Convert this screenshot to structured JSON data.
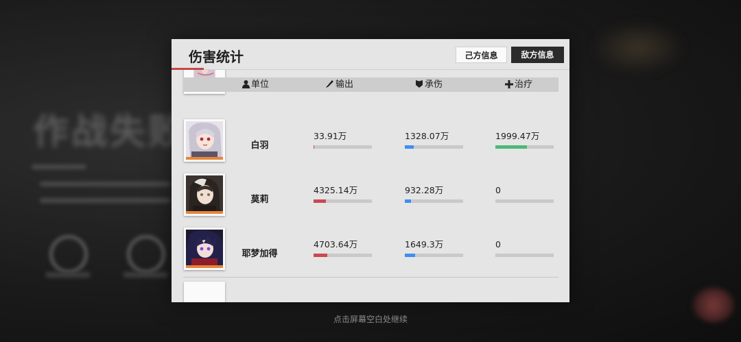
{
  "background": {
    "title": "作战失败"
  },
  "panel": {
    "title": "伤害统计",
    "tabs": {
      "own": "己方信息",
      "enemy": "敌方信息"
    },
    "columns": {
      "unit": "单位",
      "output": "输出",
      "taken": "承伤",
      "heal": "治疗"
    },
    "icons": {
      "unit": "person-icon",
      "output": "brush-icon",
      "taken": "shield-icon",
      "heal": "plus-icon"
    },
    "colors": {
      "output": "#c84a52",
      "taken": "#3f8ef0",
      "heal": "#4cba78",
      "accent": "#c84646"
    },
    "rows": [
      {
        "name": "白羽",
        "output": "33.91万",
        "taken": "1328.07万",
        "heal": "1999.47万",
        "output_ratio": 0.008,
        "taken_ratio": 0.15,
        "heal_ratio": 0.54
      },
      {
        "name": "莫莉",
        "output": "4325.14万",
        "taken": "932.28万",
        "heal": "0",
        "output_ratio": 0.21,
        "taken_ratio": 0.1,
        "heal_ratio": 0
      },
      {
        "name": "耶梦加得",
        "output": "4703.64万",
        "taken": "1649.3万",
        "heal": "0",
        "output_ratio": 0.23,
        "taken_ratio": 0.18,
        "heal_ratio": 0
      }
    ]
  },
  "hint": "点击屏幕空白处继续"
}
